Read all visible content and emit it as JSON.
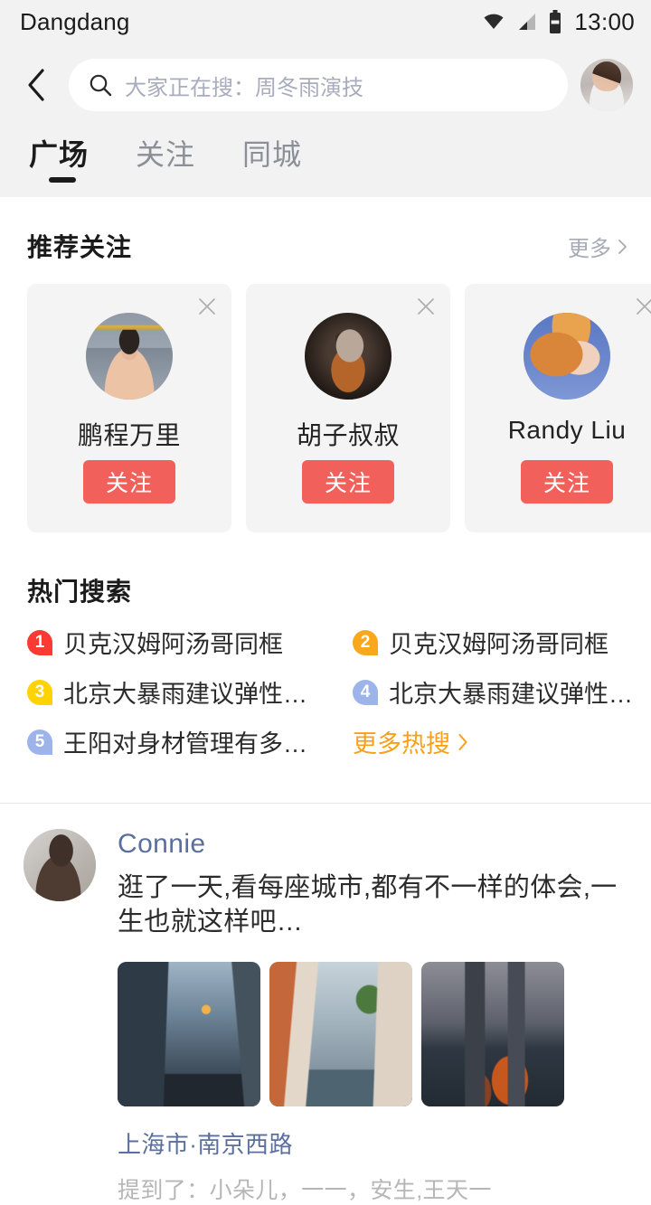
{
  "status_bar": {
    "app_title": "Dangdang",
    "time": "13:00",
    "icons": [
      "wifi-icon",
      "signal-icon",
      "battery-icon"
    ]
  },
  "search": {
    "back_icon": "back-chevron-icon",
    "search_icon": "search-icon",
    "placeholder": "大家正在搜：周冬雨演技",
    "value": "",
    "avatar_alt": "user-avatar"
  },
  "tabs": [
    {
      "label": "广场",
      "active": true
    },
    {
      "label": "关注",
      "active": false
    },
    {
      "label": "同城",
      "active": false
    }
  ],
  "recommend": {
    "title": "推荐关注",
    "more_label": "更多",
    "more_icon": "chevron-right-icon",
    "close_icon": "close-icon",
    "cards": [
      {
        "name": "鹏程万里",
        "follow_label": "关注"
      },
      {
        "name": "胡子叔叔",
        "follow_label": "关注"
      },
      {
        "name": "Randy Liu",
        "follow_label": "关注"
      }
    ]
  },
  "hot_search": {
    "title": "热门搜索",
    "items": [
      {
        "rank": "1",
        "text": "贝克汉姆阿汤哥同框",
        "color": "#fa3a33"
      },
      {
        "rank": "2",
        "text": "贝克汉姆阿汤哥同框",
        "color": "#f9a81b"
      },
      {
        "rank": "3",
        "text": "北京大暴雨建议弹性…",
        "color": "#ffd302"
      },
      {
        "rank": "4",
        "text": "北京大暴雨建议弹性…",
        "color": "#9cb4ea"
      },
      {
        "rank": "5",
        "text": "王阳对身材管理有多…",
        "color": "#9cb4ea"
      }
    ],
    "more_label": "更多热搜",
    "more_icon": "chevron-right-icon",
    "more_color": "#f9a01b"
  },
  "feed": {
    "post": {
      "avatar_alt": "connie-avatar",
      "username": "Connie",
      "content": "逛了一天,看每座城市,都有不一样的体会,一生也就这样吧…",
      "photos": [
        "city-street-photo",
        "venice-canal-photo",
        "waterfront-night-photo"
      ],
      "location": "上海市·南京西路",
      "mentions": "提到了：小朵儿，一一，安生,王天一"
    }
  },
  "colors": {
    "header_bg": "#f2f2f2",
    "accent_red": "#f2605c",
    "link_blue": "#5b6f9e",
    "orange": "#f9a01b"
  }
}
